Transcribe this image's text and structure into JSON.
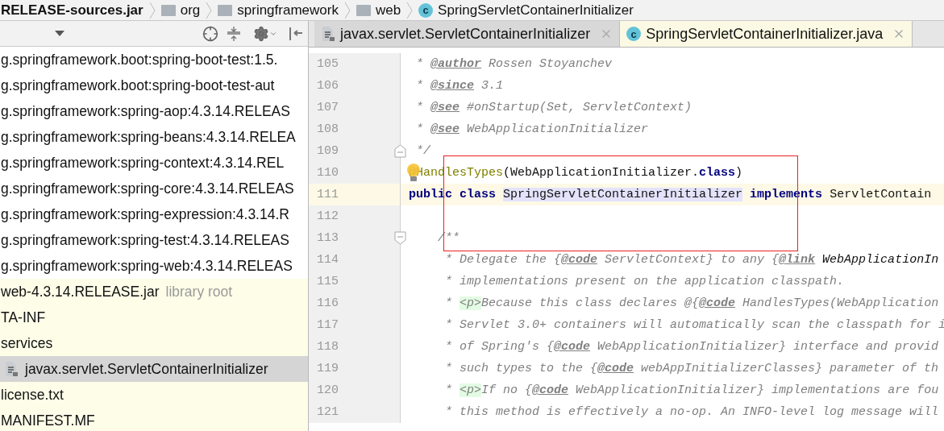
{
  "breadcrumb": [
    {
      "label": "RELEASE-sources.jar",
      "kind": "jar"
    },
    {
      "label": "org",
      "kind": "package"
    },
    {
      "label": "springframework",
      "kind": "package"
    },
    {
      "label": "web",
      "kind": "package"
    },
    {
      "label": "SpringServletContainerInitializer",
      "kind": "class",
      "icon_text": "c"
    }
  ],
  "project_tree": {
    "items": [
      {
        "label": "g.springframework.boot:spring-boot-test:1.5.",
        "kind": "library",
        "selected": false
      },
      {
        "label": "g.springframework.boot:spring-boot-test-aut",
        "kind": "library",
        "selected": false
      },
      {
        "label": "g.springframework:spring-aop:4.3.14.RELEAS",
        "kind": "library",
        "selected": false
      },
      {
        "label": "g.springframework:spring-beans:4.3.14.RELEA",
        "kind": "library",
        "selected": false
      },
      {
        "label": "g.springframework:spring-context:4.3.14.REL",
        "kind": "library",
        "selected": false
      },
      {
        "label": "g.springframework:spring-core:4.3.14.RELEAS",
        "kind": "library",
        "selected": false
      },
      {
        "label": "g.springframework:spring-expression:4.3.14.R",
        "kind": "library",
        "selected": false
      },
      {
        "label": "g.springframework:spring-test:4.3.14.RELEAS",
        "kind": "library",
        "selected": false
      },
      {
        "label": "g.springframework:spring-web:4.3.14.RELEAS",
        "kind": "library",
        "selected": false
      },
      {
        "label": "web-4.3.14.RELEASE.jar",
        "hint": "library root",
        "kind": "entry",
        "selected": false
      },
      {
        "label": "TA-INF",
        "kind": "entry",
        "selected": false
      },
      {
        "label": "services",
        "kind": "entry",
        "selected": false
      },
      {
        "label": "javax.servlet.ServletContainerInitializer",
        "kind": "file",
        "selected": true
      },
      {
        "label": "license.txt",
        "kind": "entry",
        "selected": false
      },
      {
        "label": "MANIFEST.MF",
        "kind": "entry",
        "selected": false
      }
    ]
  },
  "editor": {
    "tabs": [
      {
        "label": "javax.servlet.ServletContainerInitializer",
        "kind": "file",
        "selected": false
      },
      {
        "label": "SpringServletContainerInitializer.java",
        "kind": "class",
        "icon_text": "c",
        "selected": true
      }
    ],
    "lines": [
      {
        "number": "105",
        "segments": [
          {
            "text": " * ",
            "kind": "comment"
          },
          {
            "text": "@author",
            "kind": "tag"
          },
          {
            "text": " Rossen Stoyanchev",
            "kind": "comment"
          }
        ]
      },
      {
        "number": "106",
        "segments": [
          {
            "text": " * ",
            "kind": "comment"
          },
          {
            "text": "@since",
            "kind": "tag"
          },
          {
            "text": " 3.1",
            "kind": "comment"
          }
        ]
      },
      {
        "number": "107",
        "segments": [
          {
            "text": " * ",
            "kind": "comment"
          },
          {
            "text": "@see",
            "kind": "tag"
          },
          {
            "text": " #onStartup(Set, ServletContext)",
            "kind": "comment"
          }
        ]
      },
      {
        "number": "108",
        "segments": [
          {
            "text": " * ",
            "kind": "comment"
          },
          {
            "text": "@see",
            "kind": "tag"
          },
          {
            "text": " WebApplicationInitializer",
            "kind": "comment"
          }
        ]
      },
      {
        "number": "109",
        "kind": "fold_end",
        "segments": [
          {
            "text": " */",
            "kind": "comment"
          }
        ]
      },
      {
        "number": "110",
        "bulb": true,
        "segments": [
          {
            "text": "@HandlesTypes",
            "kind": "annotation"
          },
          {
            "text": "(WebApplicationInitializer.",
            "kind": "plain"
          },
          {
            "text": "class",
            "kind": "keyword"
          },
          {
            "text": ")",
            "kind": "plain"
          }
        ]
      },
      {
        "number": "111",
        "current": true,
        "segments": [
          {
            "text": "public class ",
            "kind": "keyword"
          },
          {
            "text": "SpringServletContainerInitializer",
            "kind": "selected"
          },
          {
            "text": " implements",
            "kind": "keyword"
          },
          {
            "text": " ServletContain",
            "kind": "plain"
          }
        ]
      },
      {
        "number": "112"
      },
      {
        "number": "113",
        "kind": "fold_start",
        "segments": [
          {
            "text": "    /**",
            "kind": "comment"
          }
        ]
      },
      {
        "number": "114",
        "segments": [
          {
            "text": "     * Delegate the {",
            "kind": "comment"
          },
          {
            "text": "@code",
            "kind": "tag"
          },
          {
            "text": " ServletContext} to any {",
            "kind": "comment"
          },
          {
            "text": "@link",
            "kind": "tag"
          },
          {
            "text": " WebApplicationIn",
            "kind": "reference"
          }
        ]
      },
      {
        "number": "115",
        "segments": [
          {
            "text": "     * implementations present on the application classpath.",
            "kind": "comment"
          }
        ]
      },
      {
        "number": "116",
        "segments": [
          {
            "text": "     * ",
            "kind": "comment"
          },
          {
            "text": "<p>",
            "kind": "html"
          },
          {
            "text": "Because this class declares @{",
            "kind": "comment"
          },
          {
            "text": "@code",
            "kind": "tag"
          },
          {
            "text": " HandlesTypes(WebApplication",
            "kind": "comment"
          }
        ]
      },
      {
        "number": "117",
        "segments": [
          {
            "text": "     * Servlet 3.0+ containers will automatically scan the classpath for i",
            "kind": "comment"
          }
        ]
      },
      {
        "number": "118",
        "segments": [
          {
            "text": "     * of Spring's {",
            "kind": "comment"
          },
          {
            "text": "@code",
            "kind": "tag"
          },
          {
            "text": " WebApplicationInitializer} interface and provid",
            "kind": "comment"
          }
        ]
      },
      {
        "number": "119",
        "segments": [
          {
            "text": "     * such types to the {",
            "kind": "comment"
          },
          {
            "text": "@code",
            "kind": "tag"
          },
          {
            "text": " webAppInitializerClasses} parameter of th",
            "kind": "comment"
          }
        ]
      },
      {
        "number": "120",
        "segments": [
          {
            "text": "     * ",
            "kind": "comment"
          },
          {
            "text": "<p>",
            "kind": "html"
          },
          {
            "text": "If no {",
            "kind": "comment"
          },
          {
            "text": "@code",
            "kind": "tag"
          },
          {
            "text": " WebApplicationInitializer} implementations are fou",
            "kind": "comment"
          }
        ]
      },
      {
        "number": "121",
        "segments": [
          {
            "text": "     * this method is effectively a no-op. An INFO-level log message will",
            "kind": "comment"
          }
        ]
      }
    ]
  }
}
